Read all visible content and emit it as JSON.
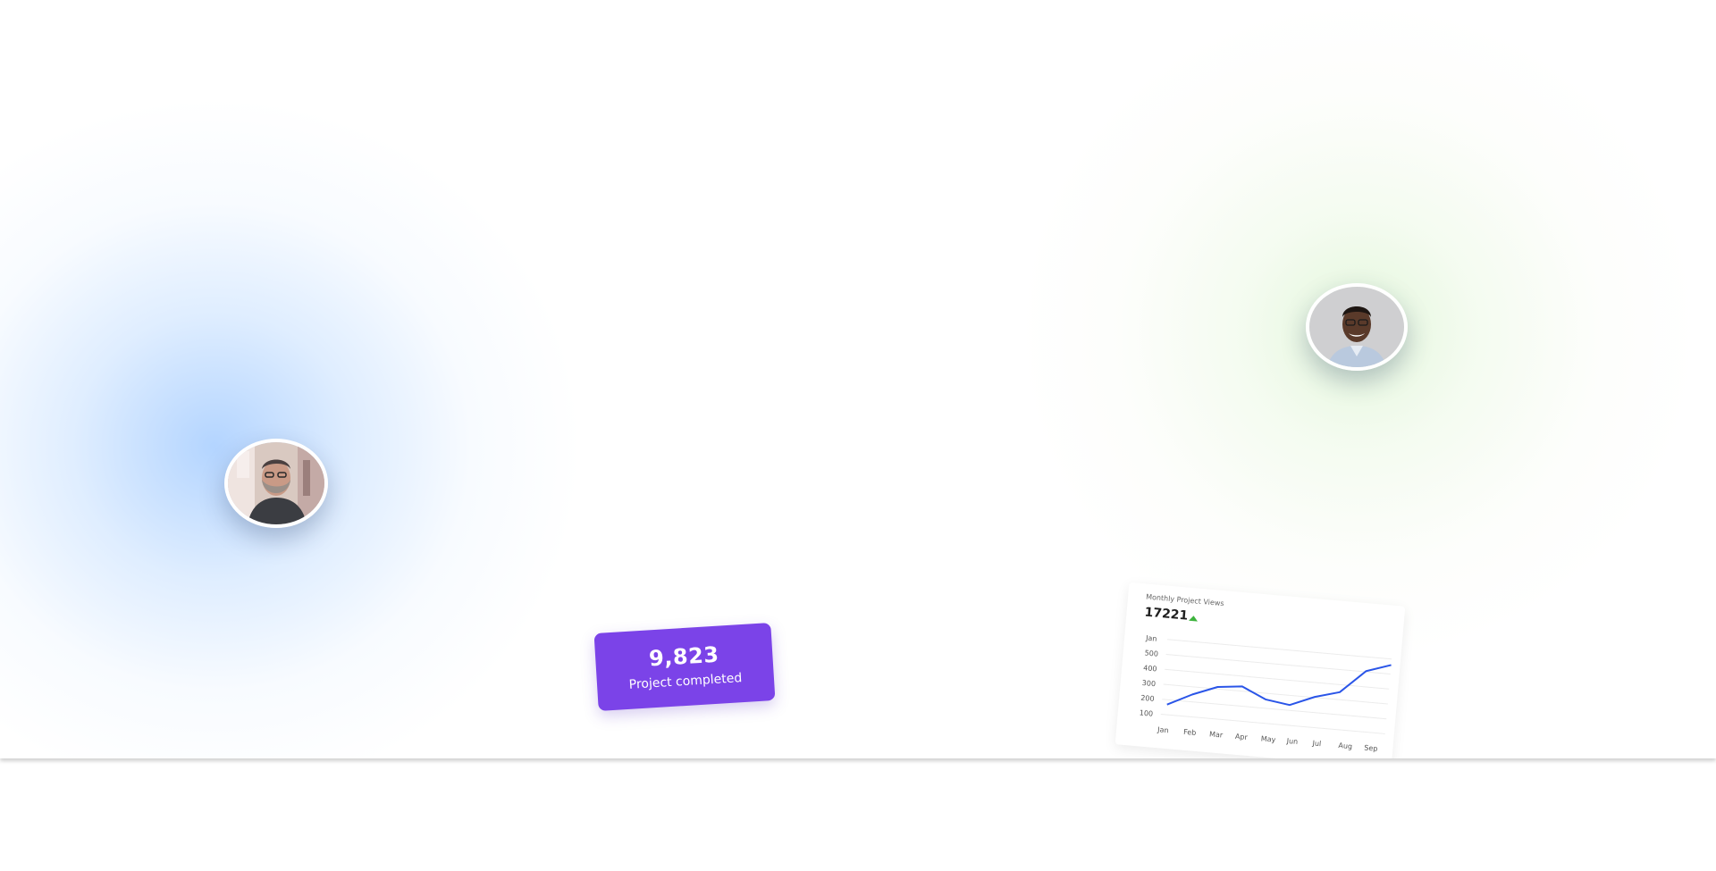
{
  "stat_card": {
    "value": "9,823",
    "label": "Project completed"
  },
  "avatars": [
    {
      "name": "bearded-man-avatar"
    },
    {
      "name": "smiling-man-avatar"
    }
  ],
  "colors": {
    "stat_card_bg": "#7b43e8",
    "chart_line": "#2a55e8",
    "trend_up": "#3db33d",
    "glow_left": "#bcd9ff",
    "glow_right": "#e2f5d8"
  },
  "trend_icon": "triangle-up-icon",
  "chart_data": {
    "type": "line",
    "title": "Monthly Project Views",
    "total_label": "17221",
    "categories": [
      "Jan",
      "Feb",
      "Mar",
      "Apr",
      "May",
      "Jun",
      "Jul",
      "Aug",
      "Sep"
    ],
    "y_ticks": [
      "Jan",
      "500",
      "400",
      "300",
      "200",
      "100"
    ],
    "series": [
      {
        "values": [
          100,
          190,
          260,
          280,
          200,
          175,
          250,
          300,
          470,
          530
        ]
      }
    ],
    "grid": true,
    "ylim": [
      0,
      600
    ]
  }
}
